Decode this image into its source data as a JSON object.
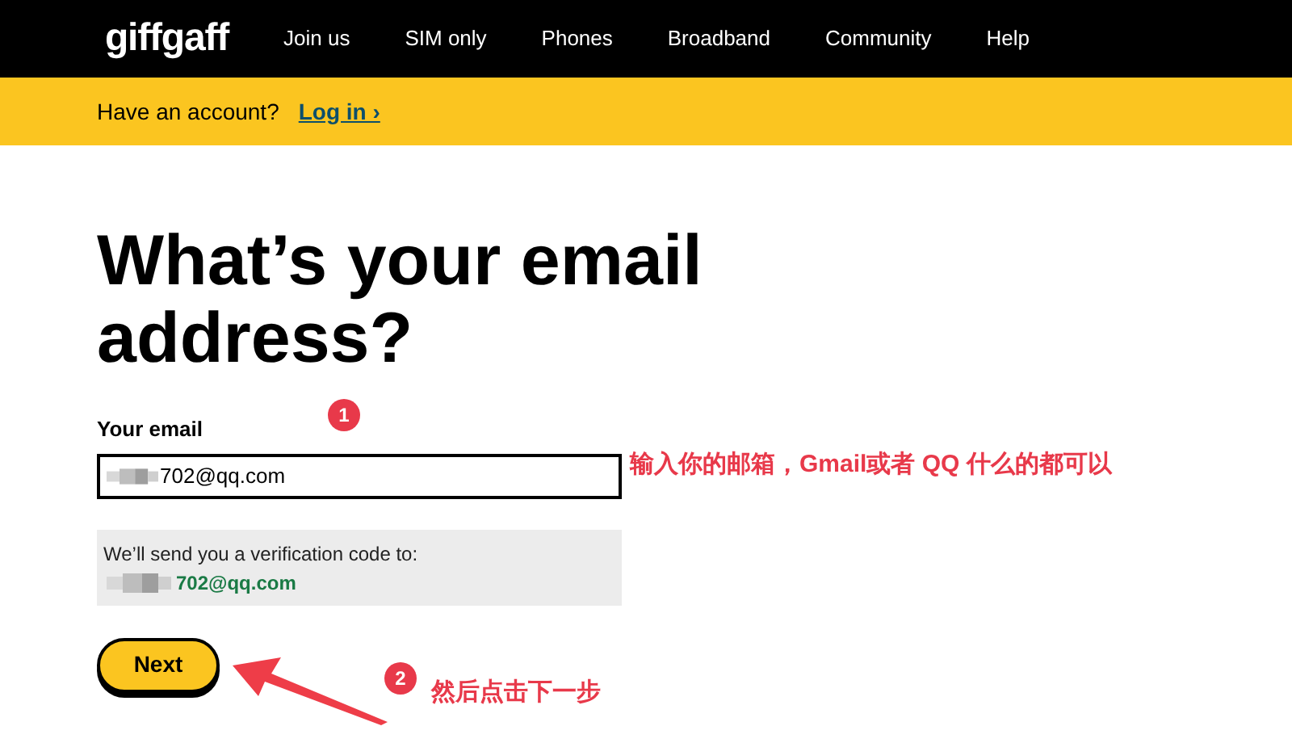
{
  "header": {
    "logo": "giffgaff",
    "nav": [
      "Join us",
      "SIM only",
      "Phones",
      "Broadband",
      "Community",
      "Help"
    ]
  },
  "account_bar": {
    "text": "Have an account?",
    "link": "Log in ›"
  },
  "heading": "What’s your email address?",
  "email_field": {
    "label": "Your email",
    "value": "702@qq.com"
  },
  "notice": {
    "text": "We’ll send you a verification code to:",
    "email": "702@qq.com"
  },
  "next_button": "Next",
  "annotations": [
    {
      "number": "1",
      "text": "输入你的邮箱，Gmail或者 QQ 什么的都可以"
    },
    {
      "number": "2",
      "text": "然后点击下一步"
    }
  ]
}
